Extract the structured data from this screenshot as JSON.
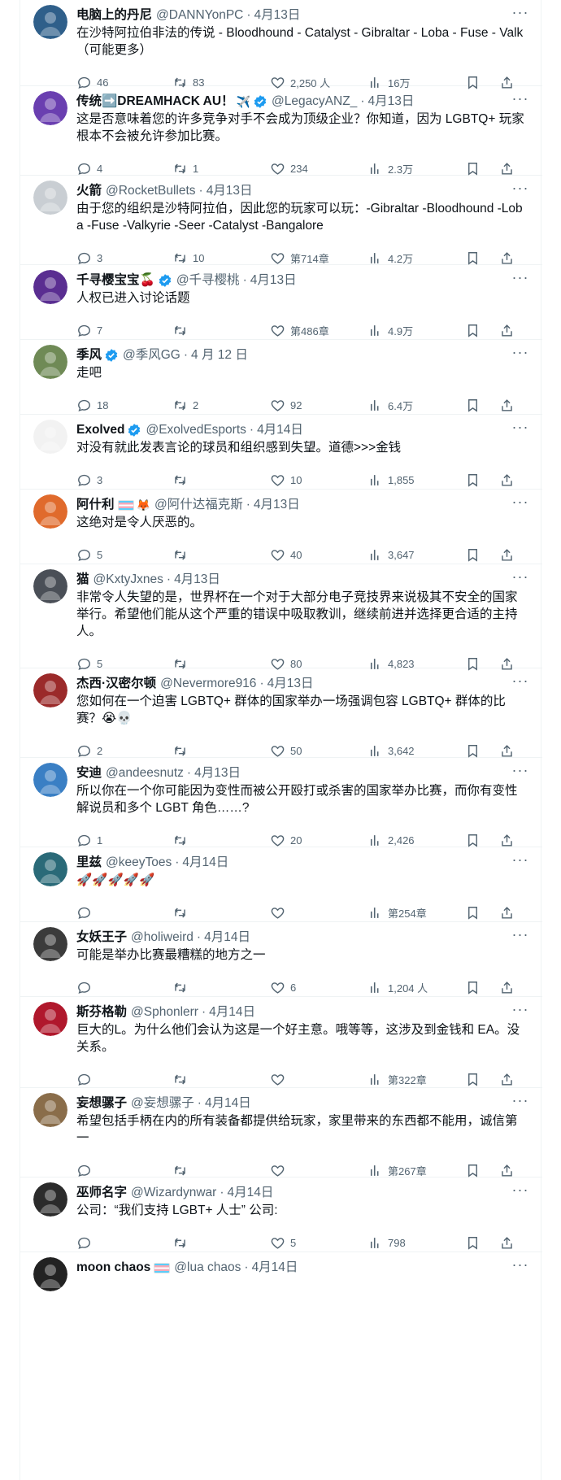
{
  "tweets": [
    {
      "name": "电脑上的丹尼",
      "handle": "@DANNYonPC",
      "time": "4月13日",
      "verified": false,
      "badge": "",
      "text": "在沙特阿拉伯非法的传说 - Bloodhound - Catalyst - Gibraltar - Loba - Fuse - Valk（可能更多）",
      "replies": "46",
      "retweets": "83",
      "likes": "2,250 人",
      "views": "16万",
      "avatar_color": "#2f5f8a"
    },
    {
      "name": "传统➡️DREAMHACK AU！",
      "handle": "@LegacyANZ_",
      "time": "4月13日",
      "verified": true,
      "badge": "✈️",
      "text": "这是否意味着您的许多竞争对手不会成为顶级企业？你知道，因为 LGBTQ+ 玩家根本不会被允许参加比赛。",
      "replies": "4",
      "retweets": "1",
      "likes": "234",
      "views": "2.3万",
      "avatar_color": "#6a3fb0"
    },
    {
      "name": "火箭",
      "handle": "@RocketBullets",
      "time": "4月13日",
      "verified": false,
      "badge": "",
      "text": "由于您的组织是沙特阿拉伯，因此您的玩家可以玩：-Gibraltar -Bloodhound -Loba -Fuse -Valkyrie -Seer -Catalyst -Bangalore",
      "replies": "3",
      "retweets": "10",
      "likes": "第714章",
      "views": "4.2万",
      "avatar_color": "#c9ced3"
    },
    {
      "name": "千寻樱宝宝🍒",
      "handle": "@千寻樱桃",
      "time": "4月13日",
      "verified": true,
      "badge": "",
      "text": "人权已进入讨论话题",
      "replies": "7",
      "retweets": "",
      "likes": "第486章",
      "views": "4.9万",
      "avatar_color": "#5a2e91"
    },
    {
      "name": "季风",
      "handle": "@季风GG",
      "time": "4 月 12 日",
      "verified": true,
      "badge": "",
      "text": "走吧",
      "replies": "18",
      "retweets": "2",
      "likes": "92",
      "views": "6.4万",
      "avatar_color": "#6f8a56"
    },
    {
      "name": "Exolved",
      "handle": "@ExolvedEsports",
      "time": "4月14日",
      "verified": true,
      "badge": "",
      "text": "对没有就此发表言论的球员和组织感到失望。道德>>>金钱",
      "replies": "3",
      "retweets": "",
      "likes": "10",
      "views": "1,855",
      "avatar_color": "#f2f2f2"
    },
    {
      "name": "阿什利",
      "handle": "@阿什达福克斯",
      "time": "4月13日",
      "verified": false,
      "badge": "🦊",
      "flag": true,
      "text": "这绝对是令人厌恶的。",
      "replies": "5",
      "retweets": "",
      "likes": "40",
      "views": "3,647",
      "avatar_color": "#e06a2c"
    },
    {
      "name": "猫",
      "handle": "@KxtyJxnes",
      "time": "4月13日",
      "verified": false,
      "badge": "",
      "text": "非常令人失望的是，世界杯在一个对于大部分电子竞技界来说极其不安全的国家举行。希望他们能从这个严重的错误中吸取教训，继续前进并选择更合适的主持人。",
      "replies": "5",
      "retweets": "",
      "likes": "80",
      "views": "4,823",
      "avatar_color": "#4a4f57"
    },
    {
      "name": "杰西·汉密尔顿",
      "handle": "@Nevermore916",
      "time": "4月13日",
      "verified": false,
      "badge": "",
      "text": "您如何在一个迫害 LGBTQ+ 群体的国家举办一场强调包容 LGBTQ+ 群体的比赛？😭💀",
      "replies": "2",
      "retweets": "",
      "likes": "50",
      "views": "3,642",
      "avatar_color": "#9b2a2a"
    },
    {
      "name": "安迪",
      "handle": "@andeesnutz",
      "time": "4月13日",
      "verified": false,
      "badge": "",
      "text": "所以你在一个你可能因为变性而被公开殴打或杀害的国家举办比赛，而你有变性解说员和多个 LGBT 角色……?",
      "replies": "1",
      "retweets": "",
      "likes": "20",
      "views": "2,426",
      "avatar_color": "#3a7fc4"
    },
    {
      "name": "里兹",
      "handle": "@keeyToes",
      "time": "4月14日",
      "verified": false,
      "badge": "",
      "text": "🚀🚀🚀🚀🚀",
      "replies": "",
      "retweets": "",
      "likes": "",
      "views": "第254章",
      "avatar_color": "#2a6a78"
    },
    {
      "name": "女妖王子",
      "handle": "@holiweird",
      "time": "4月14日",
      "verified": false,
      "badge": "",
      "text": "可能是举办比赛最糟糕的地方之一",
      "replies": "",
      "retweets": "",
      "likes": "6",
      "views": "1,204 人",
      "avatar_color": "#3b3b3b"
    },
    {
      "name": "斯芬格勒",
      "handle": "@Sphonlerr",
      "time": "4月14日",
      "verified": false,
      "badge": "",
      "text": "巨大的L。为什么他们会认为这是一个好主意。哦等等，这涉及到金钱和 EA。没关系。",
      "replies": "",
      "retweets": "",
      "likes": "",
      "views": "第322章",
      "avatar_color": "#b0182c"
    },
    {
      "name": "妄想骡子",
      "handle": "@妄想骡子",
      "time": "4月14日",
      "verified": false,
      "badge": "",
      "text": "希望包括手柄在内的所有装备都提供给玩家，家里带来的东西都不能用，诚信第一",
      "replies": "",
      "retweets": "",
      "likes": "",
      "views": "第267章",
      "avatar_color": "#8a6d4a"
    },
    {
      "name": "巫师名字",
      "handle": "@Wizardynwar",
      "time": "4月14日",
      "verified": false,
      "badge": "",
      "text": "公司：“我们支持 LGBT+ 人士” 公司:",
      "replies": "",
      "retweets": "",
      "likes": "5",
      "views": "798",
      "avatar_color": "#2b2b2b"
    },
    {
      "name": "moon chaos",
      "handle": "@lua chaos",
      "time": "4月14日",
      "verified": false,
      "badge": "",
      "flag": true,
      "text": "",
      "replies": "",
      "retweets": "",
      "likes": "",
      "views": "",
      "avatar_color": "#222222"
    }
  ],
  "colors": {
    "text": "#0f1419",
    "muted": "#536471",
    "verified": "#1d9bf0",
    "divider": "#eff3f4"
  }
}
